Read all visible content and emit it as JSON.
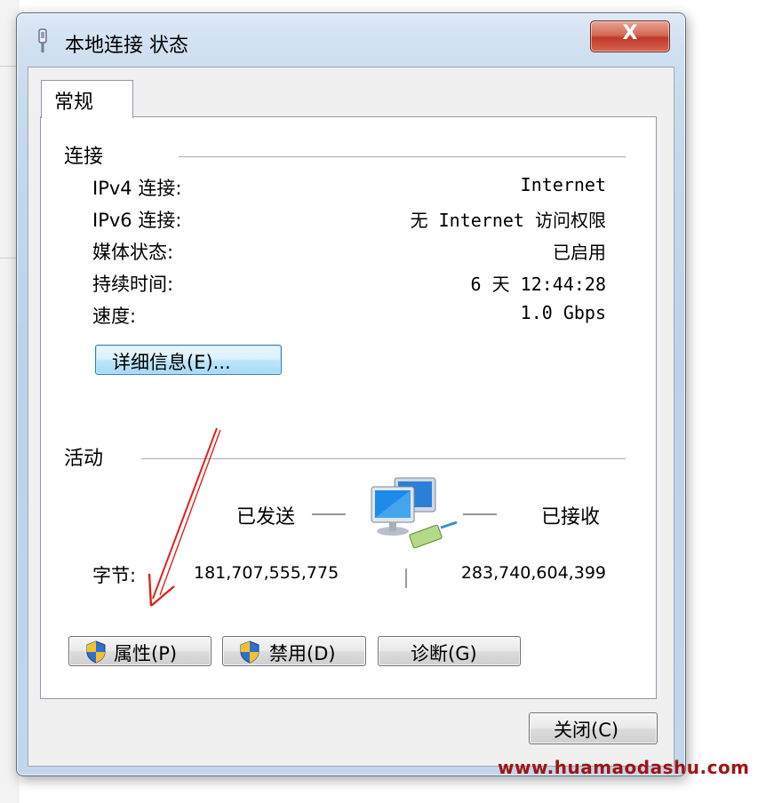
{
  "window": {
    "title": "本地连接 状态",
    "close_glyph": "X"
  },
  "tabs": [
    {
      "label": "常规"
    }
  ],
  "connection": {
    "group_title": "连接",
    "rows": [
      {
        "label": "IPv4 连接:",
        "value": "Internet"
      },
      {
        "label": "IPv6 连接:",
        "value": "无 Internet 访问权限"
      },
      {
        "label": "媒体状态:",
        "value": "已启用"
      },
      {
        "label": "持续时间:",
        "value": "6 天 12:44:28"
      },
      {
        "label": "速度:",
        "value": "1.0 Gbps"
      }
    ],
    "details_button": "详细信息(E)..."
  },
  "activity": {
    "group_title": "活动",
    "sent_label": "已发送",
    "received_label": "已接收",
    "bytes_label": "字节:",
    "bytes_sent": "181,707,555,775",
    "bytes_received": "283,740,604,399",
    "icon": "network-computers-icon"
  },
  "buttons": {
    "properties": "属性(P)",
    "disable": "禁用(D)",
    "diagnose": "诊断(G)",
    "close": "关闭(C)"
  },
  "watermark": "www.huamaodashu.com",
  "colors": {
    "annotation_arrow": "#e02020",
    "close_button": "#c7432f",
    "watermark": "#a01414"
  }
}
